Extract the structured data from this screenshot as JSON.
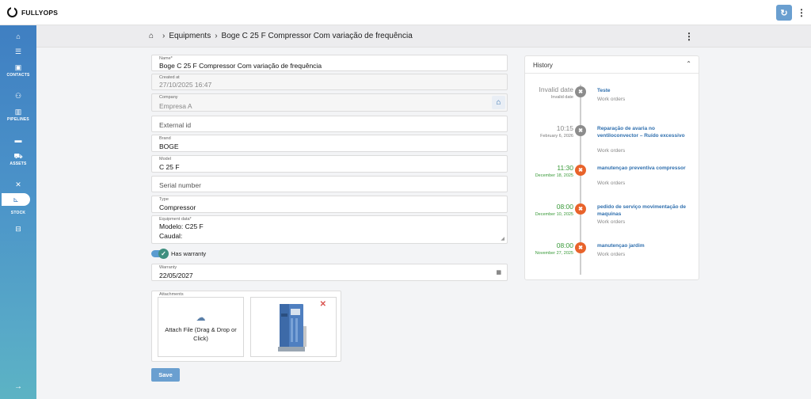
{
  "app": {
    "name": "FULLYOPS"
  },
  "sidebar": {
    "items": [
      {
        "icon": "home-icon",
        "label": ""
      },
      {
        "icon": "checklist-icon",
        "label": ""
      },
      {
        "icon": "contact-card-icon",
        "label": "CONTACTS"
      },
      {
        "icon": "people-icon",
        "label": ""
      },
      {
        "icon": "building-icon",
        "label": "PIPELINES"
      },
      {
        "icon": "briefcase-icon",
        "label": ""
      },
      {
        "icon": "truck-icon",
        "label": "ASSETS"
      },
      {
        "icon": "tools-icon",
        "label": ""
      },
      {
        "icon": "hand-truck-icon",
        "label": "STOCK"
      },
      {
        "icon": "toolbox-icon",
        "label": ""
      }
    ]
  },
  "breadcrumb": {
    "section": "Equipments",
    "current": "Boge C 25 F Compressor Com variação de frequência"
  },
  "form": {
    "name": {
      "label": "Name*",
      "value": "Boge C 25 F Compressor Com variação de frequência"
    },
    "created_at": {
      "label": "Created at",
      "value": "27/10/2025 16:47"
    },
    "company": {
      "label": "Company",
      "value": "Empresa A"
    },
    "external_id": {
      "placeholder": "External id"
    },
    "brand": {
      "label": "Brand",
      "value": "BOGE"
    },
    "model": {
      "label": "Model",
      "value": "C 25 F"
    },
    "serial_number": {
      "placeholder": "Serial number"
    },
    "type": {
      "label": "Type",
      "value": "Compressor"
    },
    "equipment_data": {
      "label": "Equipment data*",
      "line1": "Modelo: C25 F",
      "line2": "Caudal:"
    },
    "has_warranty": {
      "label": "Has warranty",
      "checked": true
    },
    "warranty": {
      "label": "Warranty",
      "value": "22/05/2027"
    },
    "attachments": {
      "label": "Attachments",
      "drop_text": "Attach File (Drag & Drop or Click)"
    },
    "save_label": "Save"
  },
  "history": {
    "title": "History",
    "entries": [
      {
        "time": "Invalid date",
        "date": "Invalid date",
        "title": "Teste",
        "sub": "Work orders",
        "color": "#8c8c8c"
      },
      {
        "time": "10:15",
        "date": "February 6, 2026",
        "title": "Reparação de avaria no ventiloconvector – Ruído excessivo",
        "sub": "Work orders",
        "color": "#8c8c8c"
      },
      {
        "time": "11:30",
        "date": "December 18, 2025",
        "title": "manutençao preventiva compressor",
        "sub": "Work orders",
        "color": "#e8632b"
      },
      {
        "time": "08:00",
        "date": "December 10, 2025",
        "title": "pedido de serviço movimentação de maquinas",
        "sub": "Work orders",
        "color": "#e8632b"
      },
      {
        "time": "08:00",
        "date": "November 27, 2025",
        "title": "manutençao jardim",
        "sub": "Work orders",
        "color": "#e8632b"
      }
    ]
  },
  "colors": {
    "accent": "#6a9fd0",
    "link": "#2f6fae",
    "orange": "#e8632b",
    "green": "#3a9a3a",
    "grey": "#8c8c8c"
  }
}
